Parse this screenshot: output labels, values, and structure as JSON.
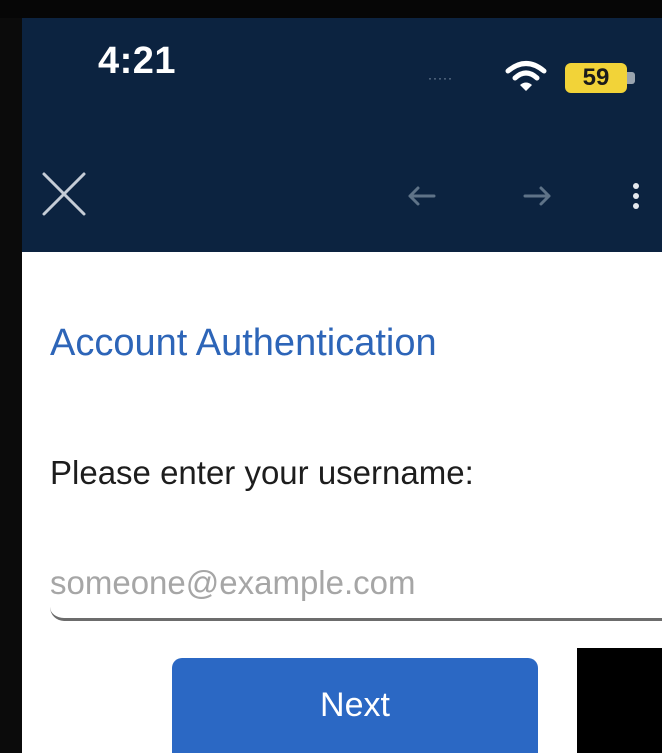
{
  "status_bar": {
    "time": "4:21",
    "signal_dots": "·····",
    "battery_level": "59",
    "colors": {
      "background": "#0c2340",
      "battery": "#f2d338"
    }
  },
  "nav_bar": {
    "icons": [
      "close-icon",
      "back-arrow-icon",
      "forward-arrow-icon",
      "more-vertical-icon"
    ]
  },
  "auth": {
    "title": "Account Authentication",
    "prompt": "Please enter your username:",
    "username": {
      "placeholder": "someone@example.com",
      "value": ""
    },
    "next_label": "Next",
    "colors": {
      "title": "#2d65b8",
      "button": "#2b68c4"
    }
  }
}
